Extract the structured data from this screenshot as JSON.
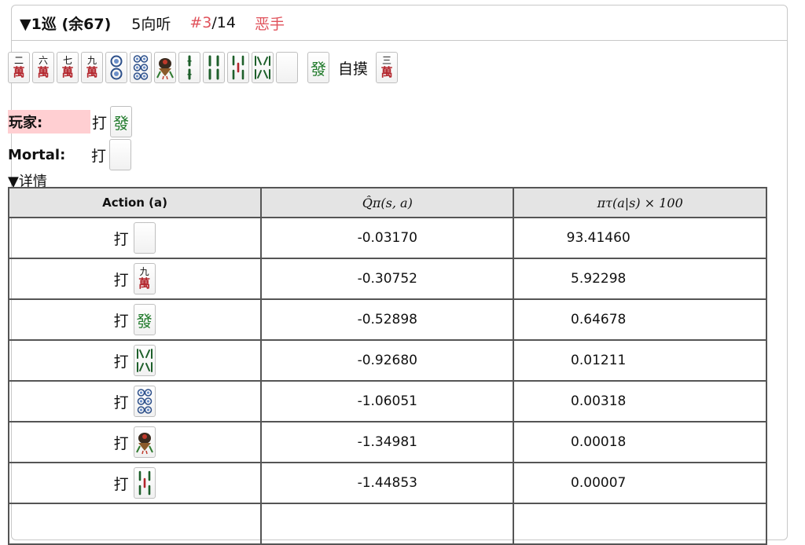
{
  "header": {
    "arrow": "▼",
    "turn": "1巡 (余67)",
    "shanten": "5向听",
    "rank_current": "#3",
    "rank_total": "/14",
    "verdict": "恶手",
    "accent_color": "#e0525b"
  },
  "hand": {
    "tiles": [
      {
        "icon": "2-man-tile",
        "num": "二",
        "suit": "萬"
      },
      {
        "icon": "6-man-tile",
        "num": "六",
        "suit": "萬"
      },
      {
        "icon": "7-man-tile",
        "num": "七",
        "suit": "萬"
      },
      {
        "icon": "9-man-tile",
        "num": "九",
        "suit": "萬"
      },
      {
        "icon": "2-pin-tile"
      },
      {
        "icon": "6-pin-tile"
      },
      {
        "icon": "1-sou-bird-tile"
      },
      {
        "icon": "2-sou-tile"
      },
      {
        "icon": "4-sou-tile"
      },
      {
        "icon": "5-sou-tile"
      },
      {
        "icon": "8-sou-tile"
      },
      {
        "icon": "white-dragon-tile"
      },
      {
        "icon": "green-dragon-tile",
        "label": "發"
      }
    ],
    "tsumo_label": "自摸",
    "tsumo_tile": {
      "icon": "3-man-tile",
      "num": "三",
      "suit": "萬"
    }
  },
  "player": {
    "name": "玩家:",
    "action": "打",
    "tile_label": "發",
    "highlight_color": "#ffcfd2"
  },
  "mortal": {
    "name": "Mortal:",
    "action": "打"
  },
  "details": {
    "toggle": "▼详情"
  },
  "table": {
    "headers": [
      "Action (a)",
      "Q̂π(s, a)",
      "πτ(a|s) × 100"
    ],
    "rows": [
      {
        "action": "打",
        "tile": "white-dragon-tile",
        "q": "-0.03170",
        "p": "93.41460"
      },
      {
        "action": "打",
        "tile": "9-man-tile",
        "num": "九",
        "suit": "萬",
        "q": "-0.30752",
        "p": "5.92298"
      },
      {
        "action": "打",
        "tile": "green-dragon-tile",
        "label": "發",
        "q": "-0.52898",
        "p": "0.64678"
      },
      {
        "action": "打",
        "tile": "8-sou-tile",
        "q": "-0.92680",
        "p": "0.01211"
      },
      {
        "action": "打",
        "tile": "6-pin-tile",
        "q": "-1.06051",
        "p": "0.00318"
      },
      {
        "action": "打",
        "tile": "1-sou-bird-tile",
        "q": "-1.34981",
        "p": "0.00018"
      },
      {
        "action": "打",
        "tile": "5-sou-tile",
        "q": "-1.44853",
        "p": "0.00007"
      }
    ]
  }
}
